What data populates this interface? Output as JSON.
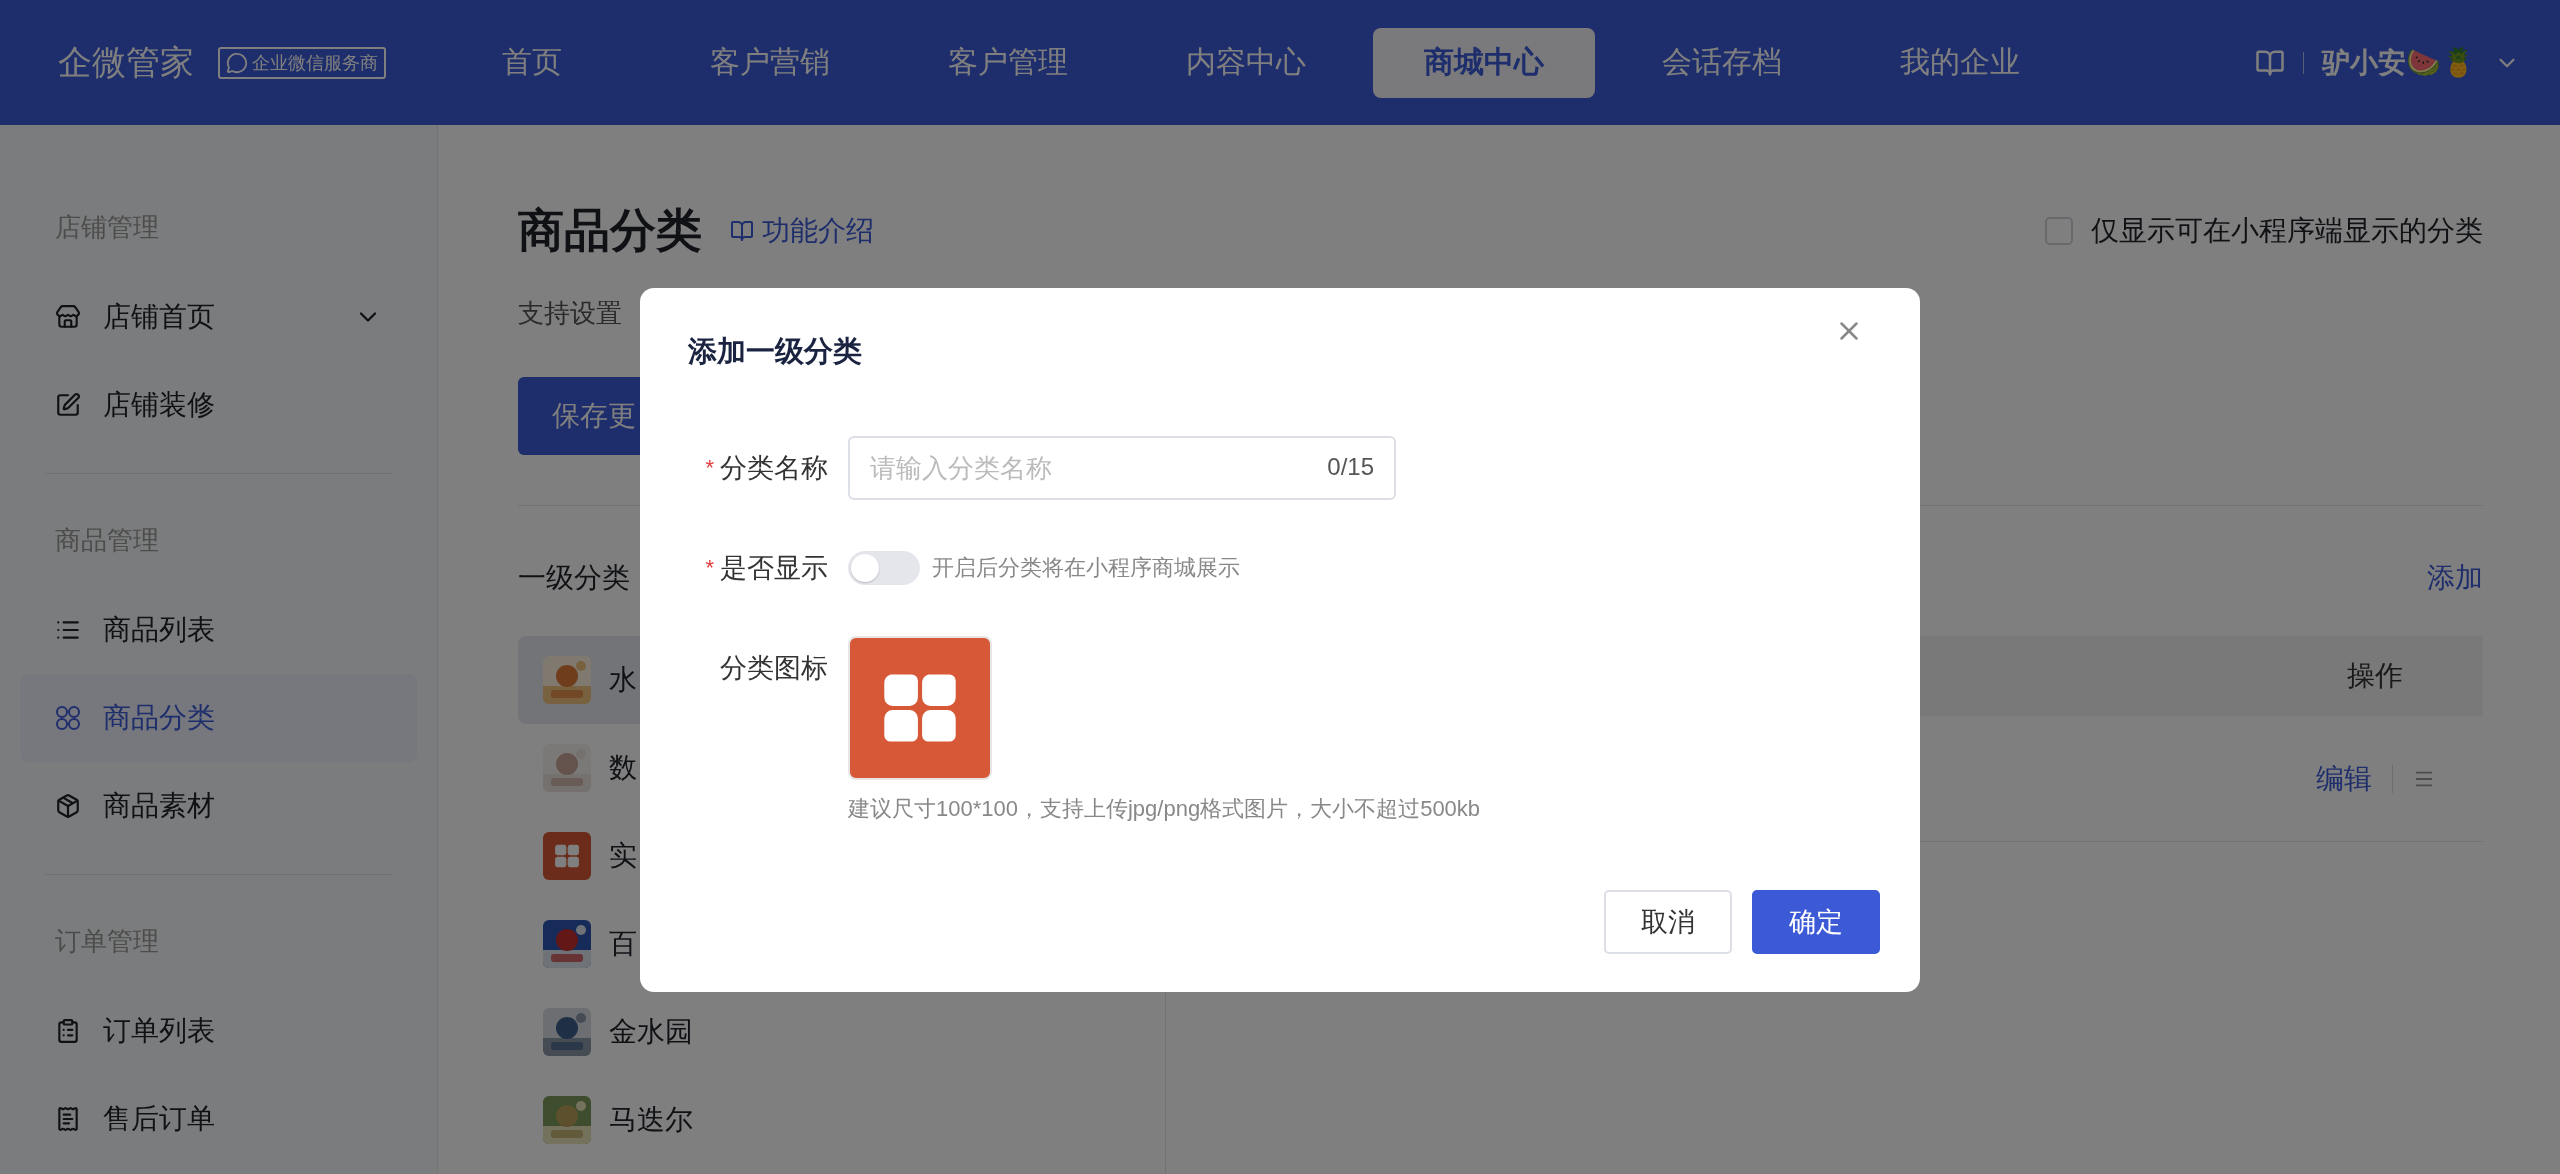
{
  "header": {
    "logo": "企微管家",
    "badge": "企业微信服务商",
    "nav": [
      {
        "label": "首页",
        "selected": false
      },
      {
        "label": "客户营销",
        "selected": false
      },
      {
        "label": "客户管理",
        "selected": false
      },
      {
        "label": "内容中心",
        "selected": false
      },
      {
        "label": "商城中心",
        "selected": true
      },
      {
        "label": "会话存档",
        "selected": false
      },
      {
        "label": "我的企业",
        "selected": false
      }
    ],
    "user": "驴小安🍉🍍"
  },
  "sidebar": {
    "groups": [
      {
        "title": "店铺管理",
        "items": [
          {
            "label": "店铺首页",
            "selected": false,
            "expandable": true
          },
          {
            "label": "店铺装修",
            "selected": false,
            "expandable": false
          }
        ]
      },
      {
        "title": "商品管理",
        "items": [
          {
            "label": "商品列表",
            "selected": false,
            "expandable": false
          },
          {
            "label": "商品分类",
            "selected": true,
            "expandable": false
          },
          {
            "label": "商品素材",
            "selected": false,
            "expandable": false
          }
        ]
      },
      {
        "title": "订单管理",
        "items": [
          {
            "label": "订单列表",
            "selected": false,
            "expandable": false
          },
          {
            "label": "售后订单",
            "selected": false,
            "expandable": false
          }
        ]
      }
    ]
  },
  "page": {
    "title": "商品分类",
    "intro_link": "功能介绍",
    "filter_checkbox": {
      "label": "仅显示可在小程序端显示的分类",
      "checked": false
    },
    "subtitle": "支持设置",
    "save_button": "保存更",
    "section_title": "一级分类",
    "add_link": "添加",
    "categories": [
      {
        "name": "水",
        "kind": "picture",
        "selected": true
      },
      {
        "name": "数",
        "kind": "picture",
        "selected": false
      },
      {
        "name": "实",
        "kind": "icon",
        "selected": false
      },
      {
        "name": "百",
        "kind": "picture",
        "selected": false
      },
      {
        "name": "金水园",
        "kind": "picture",
        "selected": false
      },
      {
        "name": "马迭尔",
        "kind": "picture",
        "selected": false
      }
    ],
    "table": {
      "columns": [
        "操作"
      ],
      "rows": [
        {
          "actions": [
            "编辑"
          ]
        }
      ]
    }
  },
  "modal": {
    "title": "添加一级分类",
    "fields": [
      {
        "kind": "text",
        "label": "分类名称",
        "required_mark": "*",
        "placeholder": "请输入分类名称",
        "counter": "0/15"
      },
      {
        "kind": "switch",
        "label": "是否显示",
        "required_mark": "*",
        "on": false,
        "hint": "开启后分类将在小程序商城展示"
      },
      {
        "label": "分类图标",
        "hint": "建议尺寸100*100，支持上传jpg/png格式图片，大小不超过500kb"
      }
    ],
    "buttons": [
      {
        "label": "取消",
        "kind": "default"
      },
      {
        "label": "确定",
        "kind": "primary"
      }
    ]
  }
}
